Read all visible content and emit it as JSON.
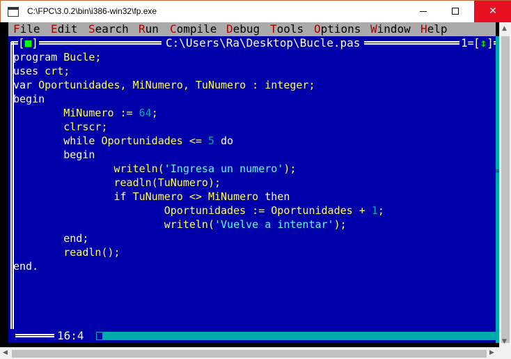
{
  "window": {
    "title": "C:\\FPC\\3.0.2\\bin\\i386-win32\\fp.exe",
    "minimize": "—",
    "maximize": "☐",
    "close": "✕"
  },
  "menu": [
    {
      "hot": "F",
      "rest": "ile"
    },
    {
      "hot": "E",
      "rest": "dit"
    },
    {
      "hot": "S",
      "rest": "earch"
    },
    {
      "hot": "R",
      "rest": "un"
    },
    {
      "hot": "C",
      "rest": "ompile"
    },
    {
      "hot": "D",
      "rest": "ebug"
    },
    {
      "hot": "T",
      "rest": "ools"
    },
    {
      "hot": "O",
      "rest": "ptions"
    },
    {
      "hot": "W",
      "rest": "indow"
    },
    {
      "hot": "H",
      "rest": "elp"
    }
  ],
  "editor": {
    "file_title": "C:\\Users\\Ra\\Desktop\\Bucle.pas",
    "close_box_left": "[",
    "close_box_mark": "■",
    "close_box_right": "]",
    "window_number": "1=",
    "zoom_left": "[",
    "zoom_mark": "↕",
    "zoom_right": "]",
    "cursor_position": "16:4"
  },
  "code": [
    [
      [
        "kw",
        "program "
      ],
      [
        "id",
        "Bucle"
      ],
      [
        "sym",
        ";"
      ]
    ],
    [
      [
        "kw",
        "uses "
      ],
      [
        "id",
        "crt"
      ],
      [
        "sym",
        ";"
      ]
    ],
    [
      [
        "kw",
        "var "
      ],
      [
        "id",
        "Oportunidades"
      ],
      [
        "sym",
        ", "
      ],
      [
        "id",
        "MiNumero"
      ],
      [
        "sym",
        ", "
      ],
      [
        "id",
        "TuNumero"
      ],
      [
        "sym",
        " : "
      ],
      [
        "id",
        "integer"
      ],
      [
        "sym",
        ";"
      ]
    ],
    [
      [
        "kw",
        "begin"
      ]
    ],
    [
      [
        "kw",
        "        "
      ],
      [
        "id",
        "MiNumero"
      ],
      [
        "sym",
        " := "
      ],
      [
        "num",
        "64"
      ],
      [
        "sym",
        ";"
      ]
    ],
    [
      [
        "kw",
        "        "
      ],
      [
        "id",
        "clrscr"
      ],
      [
        "sym",
        ";"
      ]
    ],
    [
      [
        "kw",
        "        while "
      ],
      [
        "id",
        "Oportunidades"
      ],
      [
        "sym",
        " <= "
      ],
      [
        "num",
        "5"
      ],
      [
        "kw",
        " do"
      ]
    ],
    [
      [
        "kw",
        "        begin"
      ]
    ],
    [
      [
        "kw",
        "                "
      ],
      [
        "id",
        "writeln"
      ],
      [
        "sym",
        "("
      ],
      [
        "str",
        "'Ingresa un numero'"
      ],
      [
        "sym",
        ");"
      ]
    ],
    [
      [
        "kw",
        "                "
      ],
      [
        "id",
        "readln"
      ],
      [
        "sym",
        "("
      ],
      [
        "id",
        "TuNumero"
      ],
      [
        "sym",
        ");"
      ]
    ],
    [
      [
        "kw",
        "                if "
      ],
      [
        "id",
        "TuNumero"
      ],
      [
        "sym",
        " <> "
      ],
      [
        "id",
        "MiNumero"
      ],
      [
        "kw",
        " then"
      ]
    ],
    [
      [
        "kw",
        "                        "
      ],
      [
        "id",
        "Oportunidades"
      ],
      [
        "sym",
        " := "
      ],
      [
        "id",
        "Oportunidades"
      ],
      [
        "sym",
        " + "
      ],
      [
        "num",
        "1"
      ],
      [
        "sym",
        ";"
      ]
    ],
    [
      [
        "kw",
        "                        "
      ],
      [
        "id",
        "writeln"
      ],
      [
        "sym",
        "("
      ],
      [
        "str",
        "'Vuelve a intentar'"
      ],
      [
        "sym",
        ");"
      ]
    ],
    [
      [
        "kw",
        "        end;"
      ]
    ],
    [
      [
        "kw",
        "        "
      ],
      [
        "id",
        "readln"
      ],
      [
        "sym",
        "();"
      ]
    ],
    [
      [
        "kw",
        "end."
      ]
    ]
  ],
  "scroll_arrows": {
    "up": "▲",
    "down": "▼",
    "left": "◀",
    "right": "▶",
    "grip": "≡"
  },
  "colors": {
    "editor_bg": "#0000aa",
    "menu_bg": "#aaaaaa",
    "hotkey": "#aa0000",
    "identifier": "#ffff55",
    "string": "#55ffff",
    "number": "#00aaaa"
  }
}
